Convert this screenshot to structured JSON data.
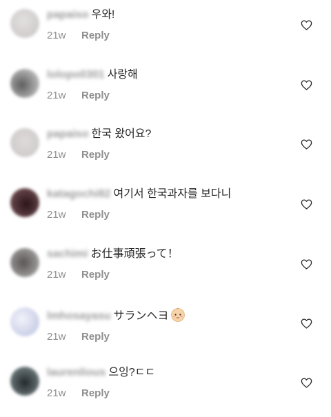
{
  "comments": [
    {
      "username": "papaiso",
      "text": "우와!",
      "time": "21w",
      "reply_label": "Reply",
      "avatar_color": "#d6d2d2",
      "like_icon": "heart-outline-icon"
    },
    {
      "username": "lolopo0301",
      "text": "사랑해",
      "time": "21w",
      "reply_label": "Reply",
      "avatar_color": "#8f8f8f",
      "like_icon": "heart-outline-icon"
    },
    {
      "username": "papaiso",
      "text": "한국 왔어요?",
      "time": "21w",
      "reply_label": "Reply",
      "avatar_color": "#d6d0d0",
      "like_icon": "heart-outline-icon"
    },
    {
      "username": "katagochi82",
      "text": "여기서 한국과자를 보다니",
      "time": "21w",
      "reply_label": "Reply",
      "avatar_color": "#4a2a2e",
      "like_icon": "heart-outline-icon"
    },
    {
      "username": "sachimi",
      "text": "お仕事頑張って！",
      "time": "21w",
      "reply_label": "Reply",
      "avatar_color": "#6e6a6a",
      "like_icon": "heart-outline-icon"
    },
    {
      "username": "lmhosayasu",
      "text": "サランヘヨ",
      "emoji": "baby-face-emoji",
      "time": "21w",
      "reply_label": "Reply",
      "avatar_color": "#dde0f0",
      "like_icon": "heart-outline-icon"
    },
    {
      "username": "laurenlious",
      "text": "으잉?ㄷㄷ",
      "time": "21w",
      "reply_label": "Reply",
      "avatar_color": "#3c4446",
      "like_icon": "heart-outline-icon"
    }
  ]
}
